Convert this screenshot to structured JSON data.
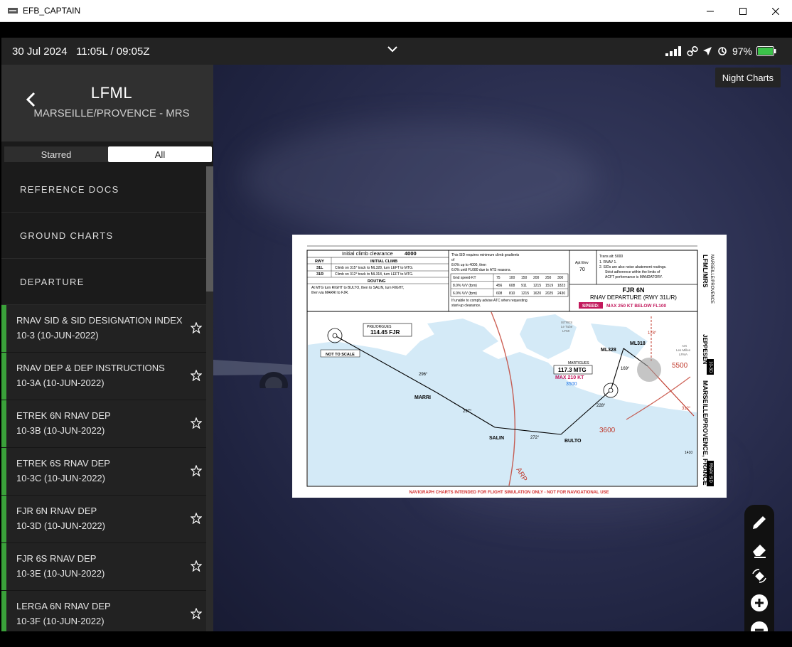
{
  "window": {
    "title": "EFB_CAPTAIN"
  },
  "status": {
    "datetime": "30 Jul 2024   11:05L / 09:05Z",
    "battery": "97%"
  },
  "airport": {
    "icao": "LFML",
    "name": "MARSEILLE/PROVENCE - MRS"
  },
  "filter": {
    "starred": "Starred",
    "all": "All"
  },
  "categories": {
    "reference": "REFERENCE DOCS",
    "ground": "GROUND CHARTS",
    "departure": "DEPARTURE"
  },
  "charts": [
    {
      "title": "RNAV SID & SID DESIGNATION INDEX",
      "sub": "10-3 (10-JUN-2022)"
    },
    {
      "title": "RNAV DEP & DEP INSTRUCTIONS",
      "sub": "10-3A (10-JUN-2022)"
    },
    {
      "title": "ETREK 6N RNAV DEP",
      "sub": "10-3B (10-JUN-2022)"
    },
    {
      "title": "ETREK 6S RNAV DEP",
      "sub": "10-3C (10-JUN-2022)"
    },
    {
      "title": "FJR 6N RNAV DEP",
      "sub": "10-3D (10-JUN-2022)"
    },
    {
      "title": "FJR 6S RNAV DEP",
      "sub": "10-3E (10-JUN-2022)"
    },
    {
      "title": "LERGA 6N RNAV DEP",
      "sub": "10-3F (10-JUN-2022)"
    }
  ],
  "night_button": "Night Charts",
  "plate": {
    "initial_climb": "Initial climb clearance",
    "initial_climb_alt": "4000",
    "rwy_hdr": "RWY",
    "climb_hdr": "INITIAL CLIMB",
    "rwy1": "31L",
    "rwy1_text": "Climb on 315° track to ML328, turn LEFT to MTG.",
    "rwy2": "31R",
    "rwy2_text": "Climb on 312° track to ML318, turn LEFT to MTG.",
    "routing_hdr": "ROUTING",
    "routing1": "At MTG turn RIGHT to BULTO, then to SALIN, turn RIGHT,",
    "routing2": "then via MARRI to FJR.",
    "grad1": "This SID requires minimum climb gradients",
    "grad2": "of",
    "grad3": "8.0% up to 4000, then",
    "grad4": "6.0% until FL080 due to ATS reasons.",
    "gnd_speed": "Gnd speed-KT",
    "speeds": [
      "75",
      "100",
      "150",
      "200",
      "250",
      "300"
    ],
    "vv1_label": "8.0% V/V (fpm)",
    "vv1": [
      "456",
      "608",
      "911",
      "1215",
      "1519",
      "1823"
    ],
    "vv2_label": "6.0% V/V (fpm)",
    "vv2": [
      "608",
      "810",
      "1215",
      "1620",
      "2025",
      "2430"
    ],
    "atc1": "If unable to comply advise ATC when requesting",
    "atc2": "start-up clearance.",
    "apt_elev_label": "Apt Elev",
    "apt_elev": "70",
    "trans1": "Trans alt: 5000",
    "trans2": "1. RNAV 1.",
    "trans3": "2. SIDs are also noise abatement routings.",
    "trans4": "Strict adherence within the limits of",
    "trans5": "ACFT performance is MANDATORY.",
    "sid_name": "FJR 6N",
    "sid_type": "RNAV DEPARTURE (RWY 31L/R)",
    "speed_label": "SPEED:",
    "speed_text": "MAX 250 KT BELOW FL100",
    "side_top": "LFML/MRS",
    "side_top2": "MARSEILLE/PROVENCE",
    "side_jep": "JEPPESEN",
    "side_city": "MARSEILLE/PROVENCE, FRANCE",
    "side_code": "10-3D",
    "side_rnav": "RNAV SID",
    "prejorgues": "PREJORGUES",
    "fjr_freq": "114.45 FJR",
    "not_to_scale": "NOT TO SCALE",
    "martigues": "MARTIGUES",
    "mtg_freq": "117.3 MTG",
    "max210": "MAX 210 KT",
    "alt3500": "3500",
    "alt5500": "5500",
    "alt3600": "3600",
    "ml318": "ML318",
    "ml328": "ML328",
    "marri": "MARRI",
    "salin": "SALIN",
    "bulto": "BULTO",
    "arp": "ARP",
    "istres": "ISTRES",
    "istres2": "Le Tube",
    "istres3": "LFMI",
    "aix": "AIX",
    "aix2": "Les Milles",
    "aix3": "LFMA",
    "leg_marri_fjr": "296°",
    "leg_salin": "297°",
    "leg_bulto": "272°",
    "leg_mtg": "228°",
    "leg_ml": "169°",
    "rwy_track": "312°",
    "top_track": "178°",
    "elev": "1410",
    "footer": "NAVIGRAPH CHARTS INTENDED FOR FLIGHT SIMULATION ONLY - NOT FOR NAVIGATIONAL USE"
  }
}
